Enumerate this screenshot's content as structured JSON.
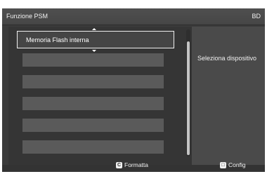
{
  "header": {
    "title": "Funzione PSM",
    "source": "BD"
  },
  "list": {
    "selected_label": "Memoria Flash interna"
  },
  "info_panel": {
    "text": "Seleziona dispositivo"
  },
  "footer": {
    "format": {
      "key": "C",
      "label": "Formatta"
    },
    "config": {
      "key": "□",
      "label": "Config"
    }
  },
  "colors": {
    "screen_bg": "#3b3b3b",
    "list_item_bg": "#5a5a5a",
    "info_bg": "#4a4a4a",
    "text": "#f2f2f2"
  }
}
